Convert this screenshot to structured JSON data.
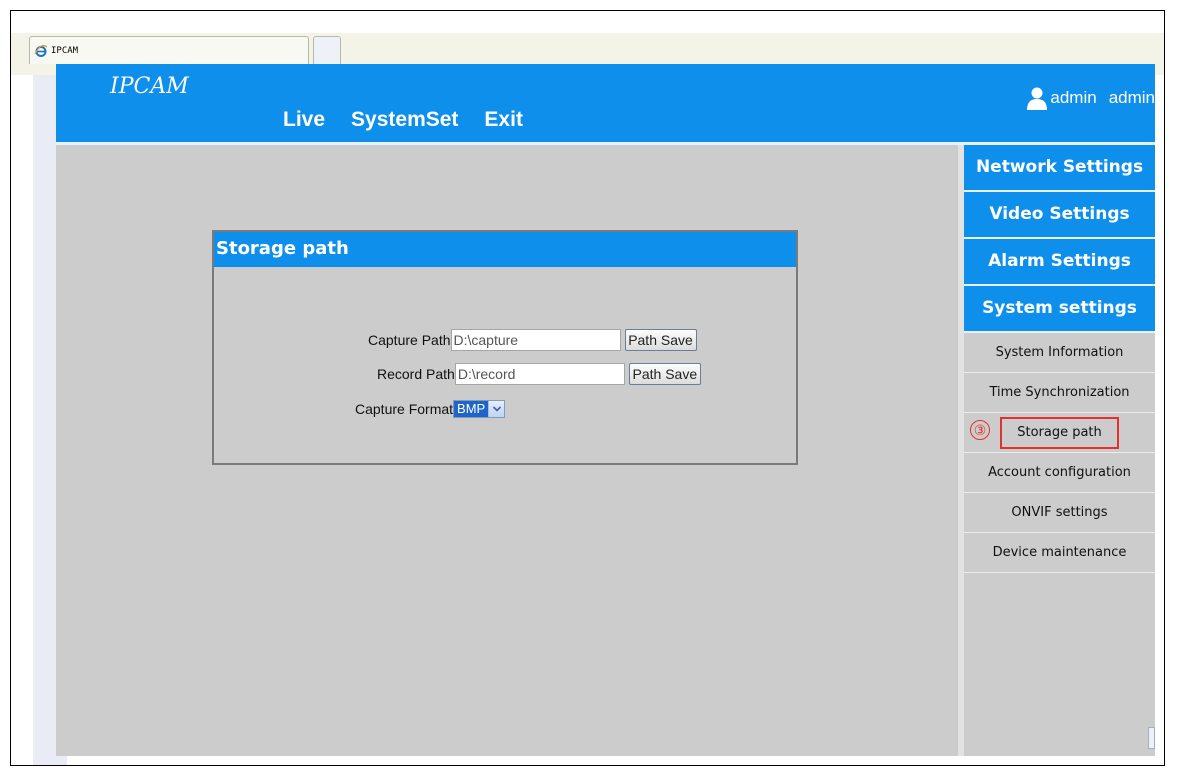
{
  "browser": {
    "tab_title": "IPCAM",
    "tab_icon": "ie-browser-icon"
  },
  "header": {
    "logo": "IPCAM",
    "nav": [
      "Live",
      "SystemSet",
      "Exit"
    ],
    "user_icon": "user-icon",
    "user_label": "admin",
    "user_label_2": "admin"
  },
  "panel": {
    "title": "Storage path",
    "capture_path_label": "Capture Path",
    "capture_path_value": "D:\\capture",
    "record_path_label": "Record Path",
    "record_path_value": "D:\\record",
    "path_save_label": "Path Save",
    "capture_format_label": "Capture Format",
    "capture_format_value": "BMP"
  },
  "sidebar": {
    "categories": [
      "Network Settings",
      "Video Settings",
      "Alarm Settings",
      "System settings"
    ],
    "items": [
      "System Information",
      "Time Synchronization",
      "Storage path",
      "Account configuration",
      "ONVIF settings",
      "Device maintenance"
    ],
    "active_index": 2,
    "step_marker": "③"
  },
  "colors": {
    "primary_blue": "#0e8fec",
    "content_gray": "#cccccc",
    "highlight_red": "#e2322e"
  }
}
